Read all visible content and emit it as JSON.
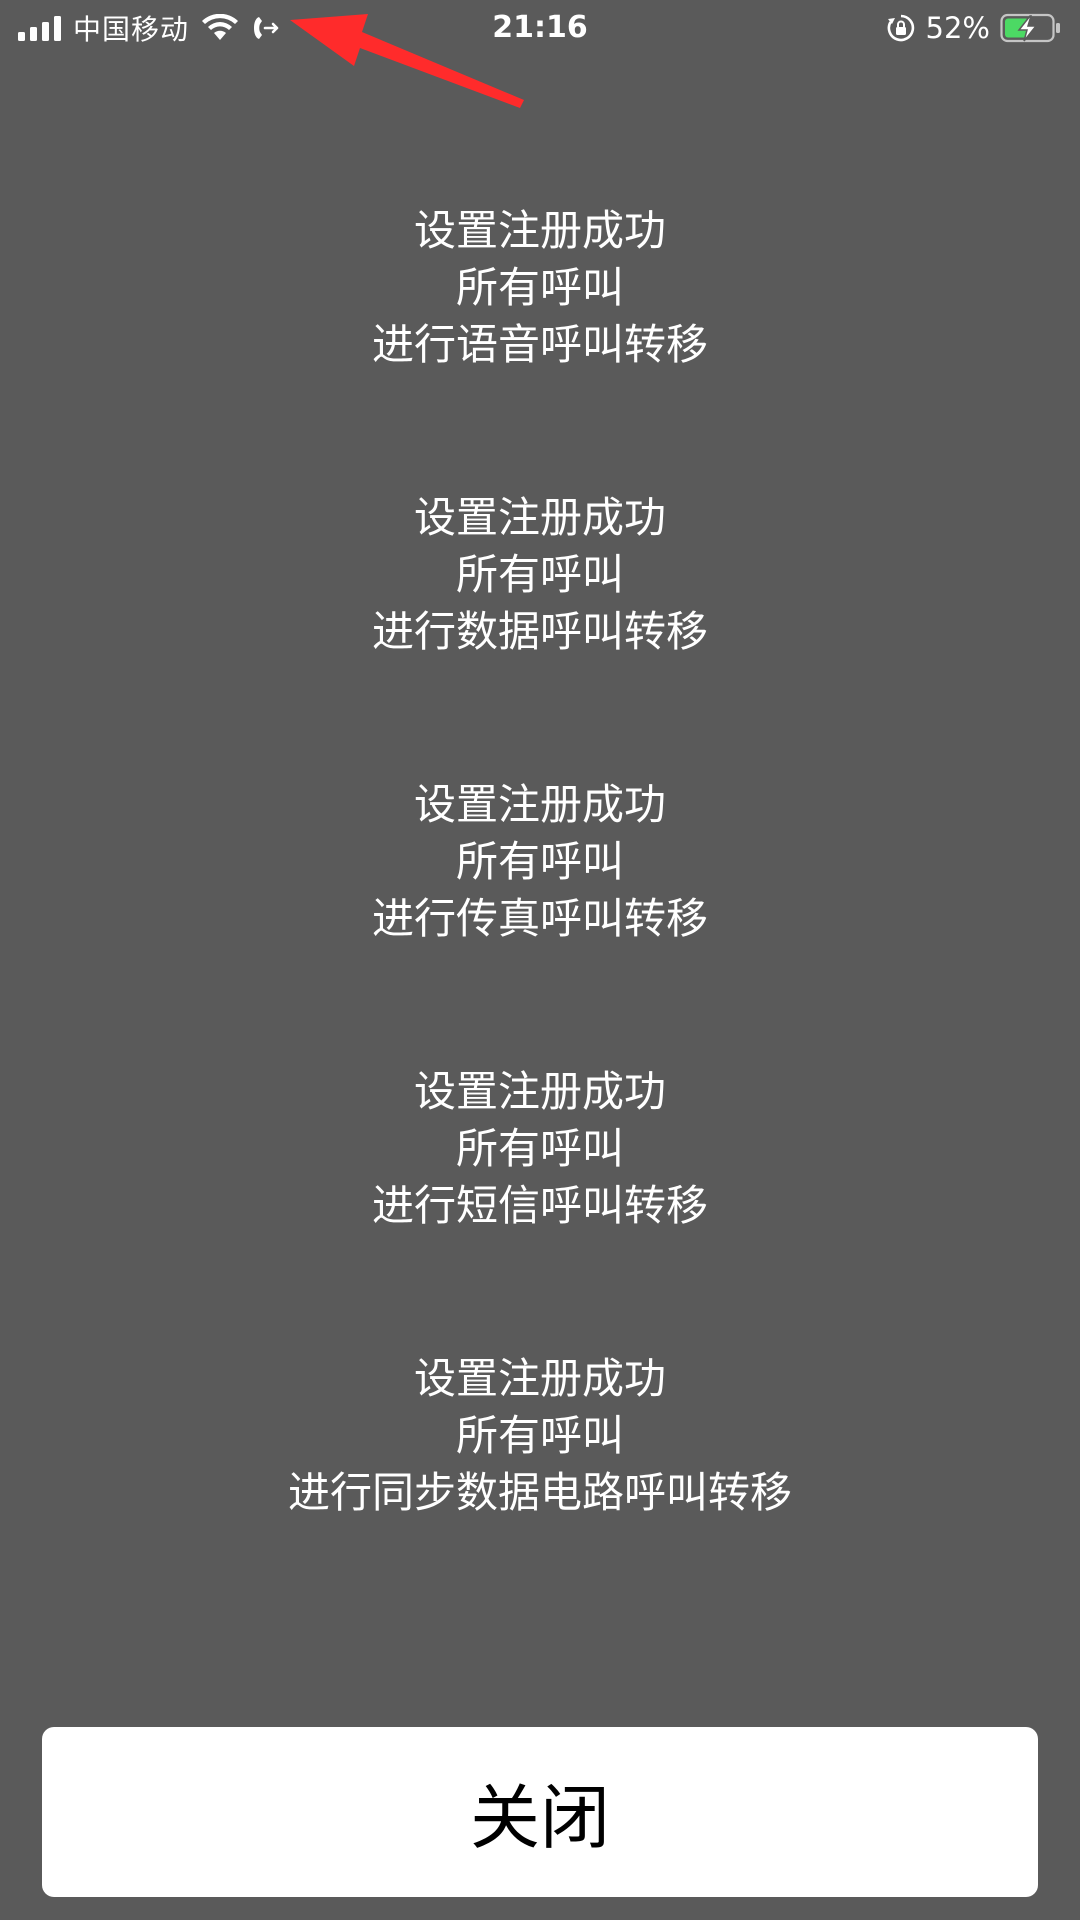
{
  "status_bar": {
    "carrier": "中国移动",
    "time": "21:16",
    "battery_percent": "52%",
    "battery_level": 0.52,
    "charging": true,
    "icons": [
      "signal-icon",
      "wifi-icon",
      "call-forwarding-icon",
      "rotation-lock-icon",
      "battery-icon",
      "charging-bolt-icon"
    ],
    "colors": {
      "annotation_arrow": "#ff2b2b",
      "battery_fill": "#4cd964"
    }
  },
  "messages": [
    {
      "line1": "设置注册成功",
      "line2": "所有呼叫",
      "line3": "进行语音呼叫转移"
    },
    {
      "line1": "设置注册成功",
      "line2": "所有呼叫",
      "line3": "进行数据呼叫转移"
    },
    {
      "line1": "设置注册成功",
      "line2": "所有呼叫",
      "line3": "进行传真呼叫转移"
    },
    {
      "line1": "设置注册成功",
      "line2": "所有呼叫",
      "line3": "进行短信呼叫转移"
    },
    {
      "line1": "设置注册成功",
      "line2": "所有呼叫",
      "line3": "进行同步数据电路呼叫转移"
    }
  ],
  "close_button": {
    "label": "关闭"
  }
}
